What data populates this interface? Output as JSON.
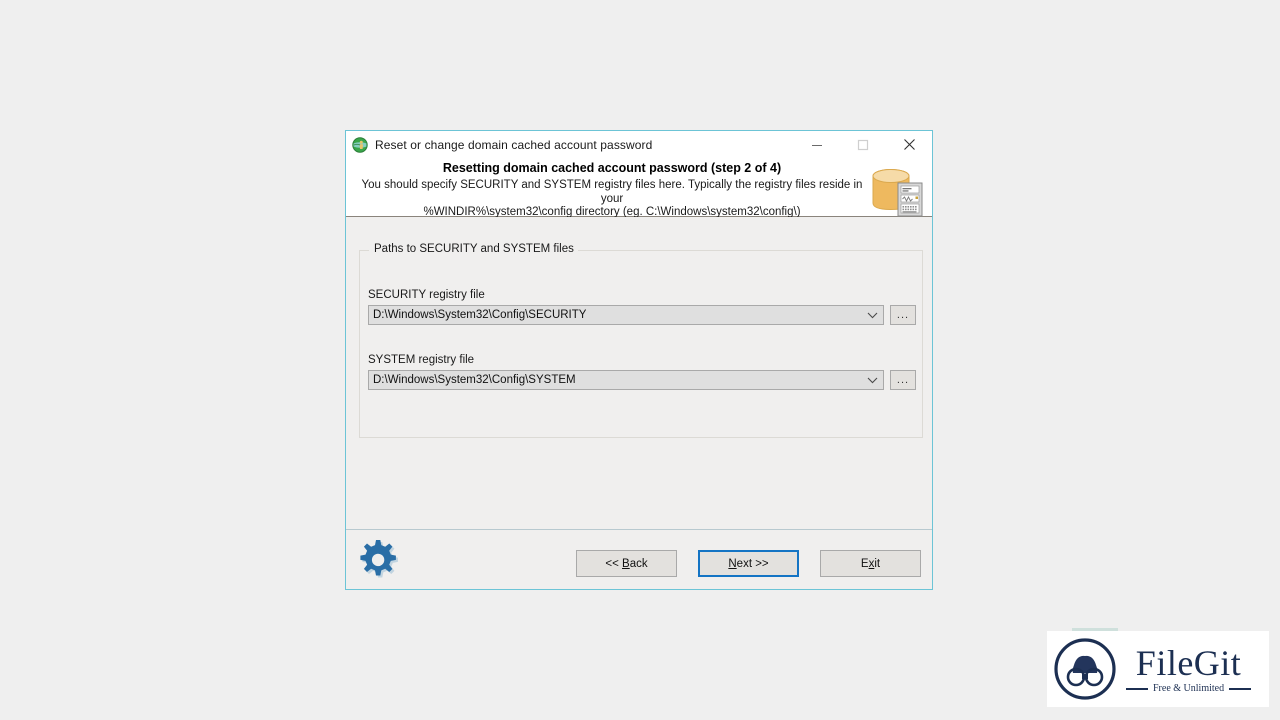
{
  "window": {
    "title": "Reset or change domain cached account password",
    "app_icon": "globe-person-icon",
    "controls": {
      "minimize": "minimize-icon",
      "maximize": "maximize-icon",
      "close": "close-icon"
    }
  },
  "header": {
    "title": "Resetting domain cached account password (step 2 of 4)",
    "subtitle_line1": "You should specify SECURITY and SYSTEM registry files here. Typically the registry files reside in your",
    "subtitle_line2": "%WINDIR%\\system32\\config directory (eg. C:\\Windows\\system32\\config\\)",
    "illustration": "database-server-icon"
  },
  "form": {
    "groupbox_legend": "Paths to SECURITY and SYSTEM files",
    "fields": [
      {
        "label": "SECURITY registry file",
        "value": "D:\\Windows\\System32\\Config\\SECURITY",
        "browse_label": "...",
        "dropdown_icon": "chevron-down-icon"
      },
      {
        "label": "SYSTEM registry file",
        "value": "D:\\Windows\\System32\\Config\\SYSTEM",
        "browse_label": "...",
        "dropdown_icon": "chevron-down-icon"
      }
    ]
  },
  "footer": {
    "gear_icon": "gear-icon",
    "buttons": [
      {
        "prefix": "<< ",
        "accel": "B",
        "suffix": "ack",
        "focused": false
      },
      {
        "prefix": "",
        "accel": "N",
        "suffix": "ext >>",
        "focused": true
      },
      {
        "prefix": "E",
        "accel": "x",
        "suffix": "it",
        "focused": false
      }
    ]
  },
  "watermark": {
    "name": "FileGit",
    "tagline": "Free & Unlimited",
    "mark_icon": "binoculars-icon"
  },
  "colors": {
    "window_border": "#6cc4d6",
    "focus_blue": "#1474c4",
    "body_bg": "#f0efee",
    "page_bg": "#efefef",
    "gear_blue": "#2a6ea6",
    "database_orange": "#edb95e",
    "watermark_navy": "#1c2f52"
  }
}
